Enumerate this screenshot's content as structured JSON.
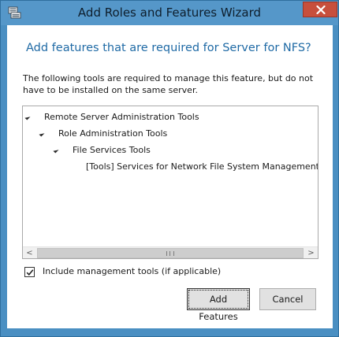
{
  "window": {
    "title": "Add Roles and Features Wizard",
    "close_glyph": "✕",
    "icon": "server-manager-icon"
  },
  "dialog": {
    "heading": "Add features that are required for Server for NFS?",
    "description": "The following tools are required to manage this feature, but do not have to be installed on the same server."
  },
  "tree": {
    "items": [
      {
        "label": "Remote Server Administration Tools",
        "expanded": true,
        "level": 0
      },
      {
        "label": "Role Administration Tools",
        "expanded": true,
        "level": 1
      },
      {
        "label": "File Services Tools",
        "expanded": true,
        "level": 2
      },
      {
        "label": "[Tools] Services for Network File System Management T",
        "expanded": false,
        "level": 3
      }
    ]
  },
  "scrollbar": {
    "left_glyph": "<",
    "right_glyph": ">"
  },
  "options": {
    "include_tools_label": "Include management tools (if applicable)",
    "include_tools_checked": true
  },
  "buttons": {
    "add_features": "Add Features",
    "cancel": "Cancel"
  }
}
